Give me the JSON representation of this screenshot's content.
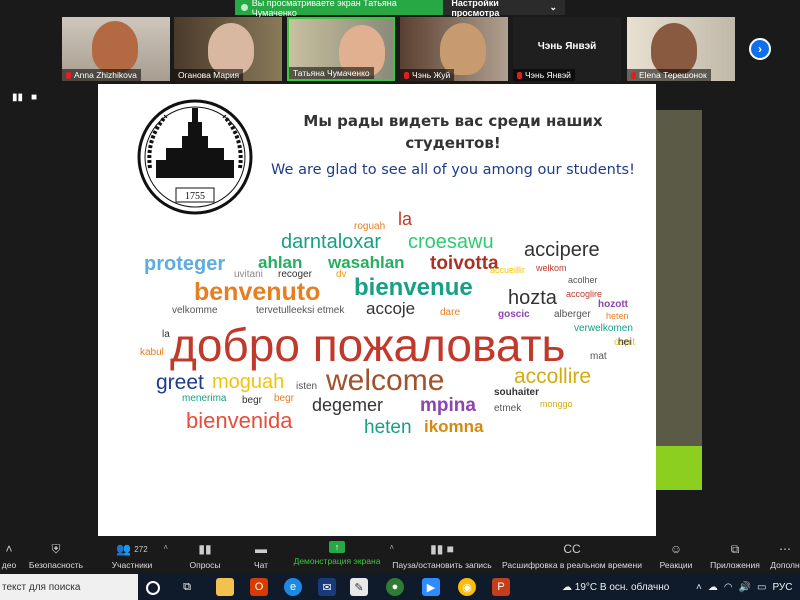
{
  "banner": {
    "sharing_text": "Вы просматриваете экран Татьяна Чумаченко",
    "view_options": "Настройки просмотра"
  },
  "participants": [
    {
      "name": "Anna Zhizhikova",
      "muted": true
    },
    {
      "name": "Оганова Мария",
      "muted": false
    },
    {
      "name": "Татьяна Чумаченко",
      "muted": false
    },
    {
      "name": "Чэнь Жуй",
      "muted": true
    },
    {
      "name": "Чэнь Янвэй",
      "muted": true,
      "video_off": true,
      "display_text": "Чэнь Янвэй"
    },
    {
      "name": "Elena Терешонок",
      "muted": true
    }
  ],
  "slide": {
    "title_ru_line1": "Мы рады видеть вас среди наших",
    "title_ru_line2": "студентов!",
    "title_en": "We are glad to see all of you among our students!",
    "logo_year": "1755",
    "words": [
      {
        "t": "la",
        "c": "#c0392b"
      },
      {
        "t": "roguah",
        "c": "#e67e22"
      },
      {
        "t": "darntaloxar",
        "c": "#16a085"
      },
      {
        "t": "croesawu",
        "c": "#2ecc71"
      },
      {
        "t": "accipere",
        "c": "#333333"
      },
      {
        "t": "proteger",
        "c": "#5dade2"
      },
      {
        "t": "ahlan",
        "c": "#27ae60"
      },
      {
        "t": "wasahlan",
        "c": "#27ae60"
      },
      {
        "t": "toivotta",
        "c": "#a93226"
      },
      {
        "t": "uvitani",
        "c": "#888888"
      },
      {
        "t": "recoger",
        "c": "#333333"
      },
      {
        "t": "dv",
        "c": "#f39c12"
      },
      {
        "t": "accueillir",
        "c": "#f1c40f"
      },
      {
        "t": "welkom",
        "c": "#c0392b"
      },
      {
        "t": "acolher",
        "c": "#555555"
      },
      {
        "t": "benvenuto",
        "c": "#e67e22"
      },
      {
        "t": "bienvenue",
        "c": "#16a085"
      },
      {
        "t": "hozta",
        "c": "#333333"
      },
      {
        "t": "accoglire",
        "c": "#c0392b"
      },
      {
        "t": "hozott",
        "c": "#8e44ad"
      },
      {
        "t": "velkomme",
        "c": "#555555"
      },
      {
        "t": "tervetulleeksi etmek",
        "c": "#555555"
      },
      {
        "t": "accoje",
        "c": "#333333"
      },
      {
        "t": "dare",
        "c": "#e67e22"
      },
      {
        "t": "goscic",
        "c": "#8e44ad"
      },
      {
        "t": "alberger",
        "c": "#555555"
      },
      {
        "t": "heten",
        "c": "#e67e22"
      },
      {
        "t": "la",
        "c": "#333333"
      },
      {
        "t": "verwelkomen",
        "c": "#16a085"
      },
      {
        "t": "ospit",
        "c": "#f1c40f"
      },
      {
        "t": "hei",
        "c": "#333333"
      },
      {
        "t": "kabul",
        "c": "#e67e22"
      },
      {
        "t": "добро пожаловать",
        "c": "#c0392b"
      },
      {
        "t": "mat",
        "c": "#555555"
      },
      {
        "t": "greet",
        "c": "#1f3c88"
      },
      {
        "t": "moguah",
        "c": "#f1c40f"
      },
      {
        "t": "isten",
        "c": "#555555"
      },
      {
        "t": "welcome",
        "c": "#a0522d"
      },
      {
        "t": "accollire",
        "c": "#d4ac0d"
      },
      {
        "t": "menerima",
        "c": "#16a085"
      },
      {
        "t": "begr",
        "c": "#333333"
      },
      {
        "t": "begr",
        "c": "#e67e22"
      },
      {
        "t": "degemer",
        "c": "#333333"
      },
      {
        "t": "mpina",
        "c": "#8e44ad"
      },
      {
        "t": "souhaiter",
        "c": "#333333"
      },
      {
        "t": "etmek",
        "c": "#555555"
      },
      {
        "t": "monggo",
        "c": "#d4ac0d"
      },
      {
        "t": "bienvenida",
        "c": "#e74c3c"
      },
      {
        "t": "heten",
        "c": "#16a085"
      },
      {
        "t": "ikomna",
        "c": "#d68910"
      }
    ]
  },
  "toolbar": {
    "items": [
      {
        "label": "део",
        "icon": "video-icon"
      },
      {
        "label": "Безопасность",
        "icon": "shield-icon"
      },
      {
        "label": "Участники",
        "icon": "participants-icon",
        "count": "272"
      },
      {
        "label": "Опросы",
        "icon": "polls-icon"
      },
      {
        "label": "Чат",
        "icon": "chat-icon"
      },
      {
        "label": "Демонстрация экрана",
        "icon": "share-screen-icon"
      },
      {
        "label": "Пауза/остановить запись",
        "icon": "record-icon"
      },
      {
        "label": "Расшифровка в реальном времени",
        "icon": "cc-icon"
      },
      {
        "label": "Реакции",
        "icon": "reactions-icon"
      },
      {
        "label": "Приложения",
        "icon": "apps-icon"
      },
      {
        "label": "Дополн",
        "icon": "more-icon"
      }
    ],
    "share_color": "#28a745"
  },
  "taskbar": {
    "search_text": "текст для поиска",
    "weather": "19°C  В осн. облачно",
    "lang": "РУС"
  }
}
